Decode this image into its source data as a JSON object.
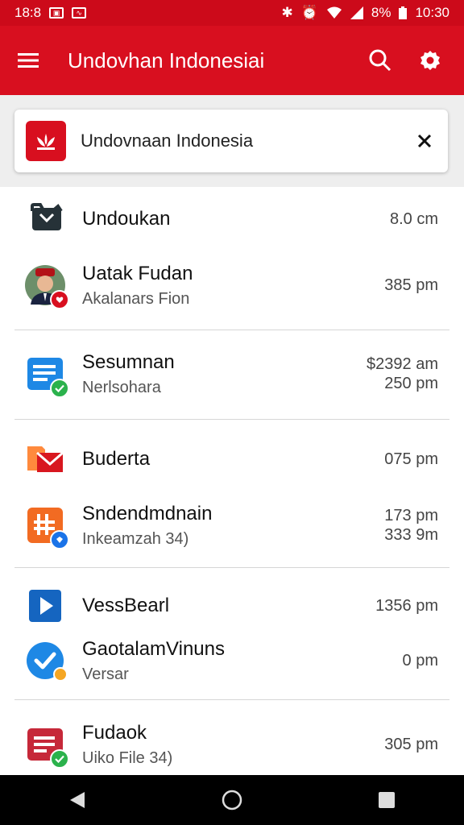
{
  "status_bar": {
    "time_left": "18:8",
    "battery": "8%",
    "time_right": "10:30"
  },
  "app_bar": {
    "title": "Undovhan Indonesiai"
  },
  "search_card": {
    "text": "Undovnaan Indonesia"
  },
  "items": [
    {
      "name": "Undoukan",
      "sub": "",
      "time": "8.0 cm",
      "time2": ""
    },
    {
      "name": "Uatak Fudan",
      "sub": "Akalanars Fion",
      "time": "385 pm",
      "time2": ""
    },
    {
      "name": "Sesumnan",
      "sub": "Nerlsohara",
      "time": "$2392 am",
      "time2": "250 pm"
    },
    {
      "name": "Buderta",
      "sub": "",
      "time": "075 pm",
      "time2": ""
    },
    {
      "name": "Sndendmdnain",
      "sub": "Inkeamzah 34)",
      "time": "173 pm",
      "time2": "333 9m"
    },
    {
      "name": "VessBearl",
      "sub": "",
      "time": "1356 pm",
      "time2": ""
    },
    {
      "name": "GaotalamVinuns",
      "sub": "Versar",
      "time": "0 pm",
      "time2": ""
    },
    {
      "name": "Fudaok",
      "sub": "Uiko File 34)",
      "time": "305 pm",
      "time2": ""
    }
  ],
  "colors": {
    "brand_red": "#d80f1f",
    "status_red": "#cc0a1a",
    "badge_green": "#2bb24c",
    "badge_blue": "#1a73e8",
    "badge_orange": "#f5a623"
  },
  "icons": [
    "menu-icon",
    "search-icon",
    "settings-gear-icon",
    "app-logo-icon",
    "close-icon",
    "back-icon",
    "home-icon",
    "recents-icon"
  ]
}
